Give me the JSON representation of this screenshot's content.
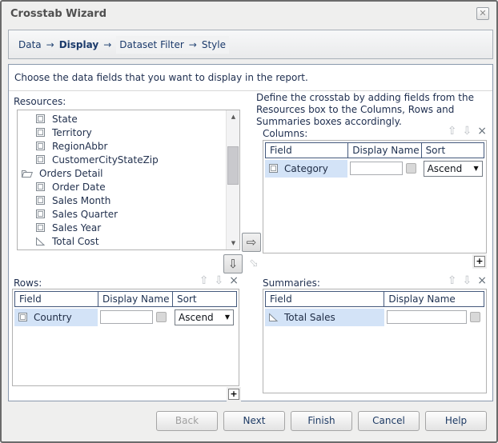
{
  "window": {
    "title": "Crosstab Wizard",
    "close_glyph": "✕"
  },
  "steps": {
    "arrow": "→",
    "items": [
      {
        "label": "Data",
        "state": "done"
      },
      {
        "label": "Display",
        "state": "current"
      },
      {
        "label": "Dataset Filter",
        "state": "future"
      },
      {
        "label": "Style",
        "state": "future"
      }
    ]
  },
  "instruction": "Choose the data fields that you want to display in the report.",
  "resources": {
    "label": "Resources:",
    "items": [
      {
        "label": "State",
        "type": "field"
      },
      {
        "label": "Territory",
        "type": "field"
      },
      {
        "label": "RegionAbbr",
        "type": "field"
      },
      {
        "label": "CustomerCityStateZip",
        "type": "field"
      },
      {
        "label": "Orders Detail",
        "type": "folder"
      },
      {
        "label": "Order Date",
        "type": "field"
      },
      {
        "label": "Sales Month",
        "type": "field"
      },
      {
        "label": "Sales Quarter",
        "type": "field"
      },
      {
        "label": "Sales Year",
        "type": "field"
      },
      {
        "label": "Total Cost",
        "type": "summary"
      }
    ]
  },
  "define_hint": "Define the crosstab by adding fields from the Resources box to the Columns, Rows and Summaries boxes accordingly.",
  "columns_box": {
    "label": "Columns:",
    "headers": [
      "Field",
      "Display Name",
      "Sort"
    ],
    "rows": [
      {
        "field": "Category",
        "icon": "field",
        "display_name": "",
        "sort": "Ascend"
      }
    ]
  },
  "rows_box": {
    "label": "Rows:",
    "headers": [
      "Field",
      "Display Name",
      "Sort"
    ],
    "rows": [
      {
        "field": "Country",
        "icon": "field",
        "display_name": "",
        "sort": "Ascend"
      }
    ]
  },
  "summaries_box": {
    "label": "Summaries:",
    "headers": [
      "Field",
      "Display Name"
    ],
    "rows": [
      {
        "field": "Total Sales",
        "icon": "summary",
        "display_name": ""
      }
    ]
  },
  "icons": {
    "move_up": "⇧",
    "move_down": "⇩",
    "remove": "×",
    "add": "+",
    "transfer_right": "⇨",
    "transfer_down": "⇩",
    "transfer_diag": "⇩",
    "dropdown": "▼",
    "scroll_up": "▲",
    "scroll_down": "▼"
  },
  "buttons": [
    {
      "label": "Back",
      "disabled": true
    },
    {
      "label": "Next",
      "disabled": false
    },
    {
      "label": "Finish",
      "disabled": false
    },
    {
      "label": "Cancel",
      "disabled": false
    },
    {
      "label": "Help",
      "disabled": false
    }
  ],
  "colors": {
    "accent_navy": "#1b3a6b",
    "selected_row": "#d3e3f7",
    "table_header_border": "#44597c",
    "dialog_bg": "#efefee"
  }
}
